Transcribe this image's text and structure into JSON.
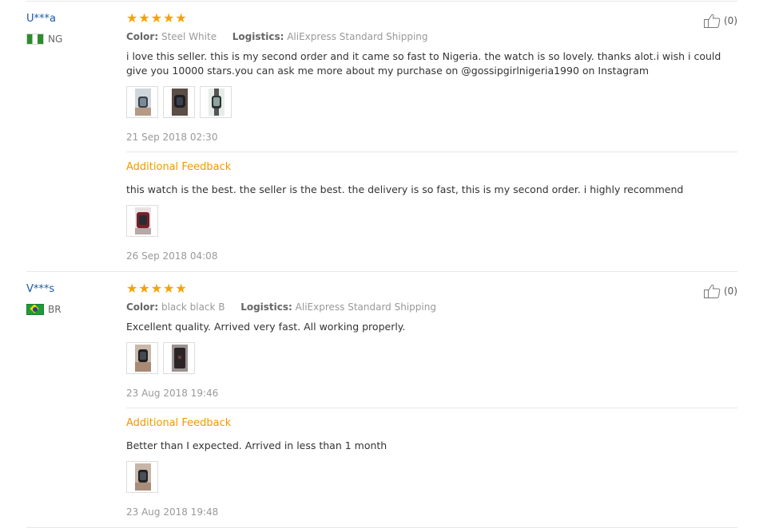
{
  "reviews": [
    {
      "user": "U***a",
      "country": "NG",
      "rating": 5,
      "color_label": "Color:",
      "color_value": "Steel White",
      "logistics_label": "Logistics:",
      "logistics_value": "AliExpress Standard Shipping",
      "helpful_count": "(0)",
      "text": "i love this seller. this is my second order and it came so fast to Nigeria. the watch is so lovely. thanks alot.i wish i could give you 10000 stars.you can ask me more about my purchase on @gossipgirlnigeria1990 on Instagram",
      "date": "21 Sep 2018 02:30",
      "additional": {
        "label": "Additional Feedback",
        "text": "this watch is the best. the seller is the best. the delivery is so fast, this is my second order. i highly recommend",
        "date": "26 Sep 2018 04:08"
      }
    },
    {
      "user": "V***s",
      "country": "BR",
      "rating": 5,
      "color_label": "Color:",
      "color_value": "black black B",
      "logistics_label": "Logistics:",
      "logistics_value": "AliExpress Standard Shipping",
      "helpful_count": "(0)",
      "text": "Excellent quality. Arrived very fast. All working properly.",
      "date": "23 Aug 2018 19:46",
      "additional": {
        "label": "Additional Feedback",
        "text": "Better than I expected. Arrived in less than 1 month",
        "date": "23 Aug 2018 19:48"
      }
    }
  ],
  "colors": {
    "star": "#f5a300",
    "username": "#1a5aa8",
    "additional": "#f39800"
  }
}
